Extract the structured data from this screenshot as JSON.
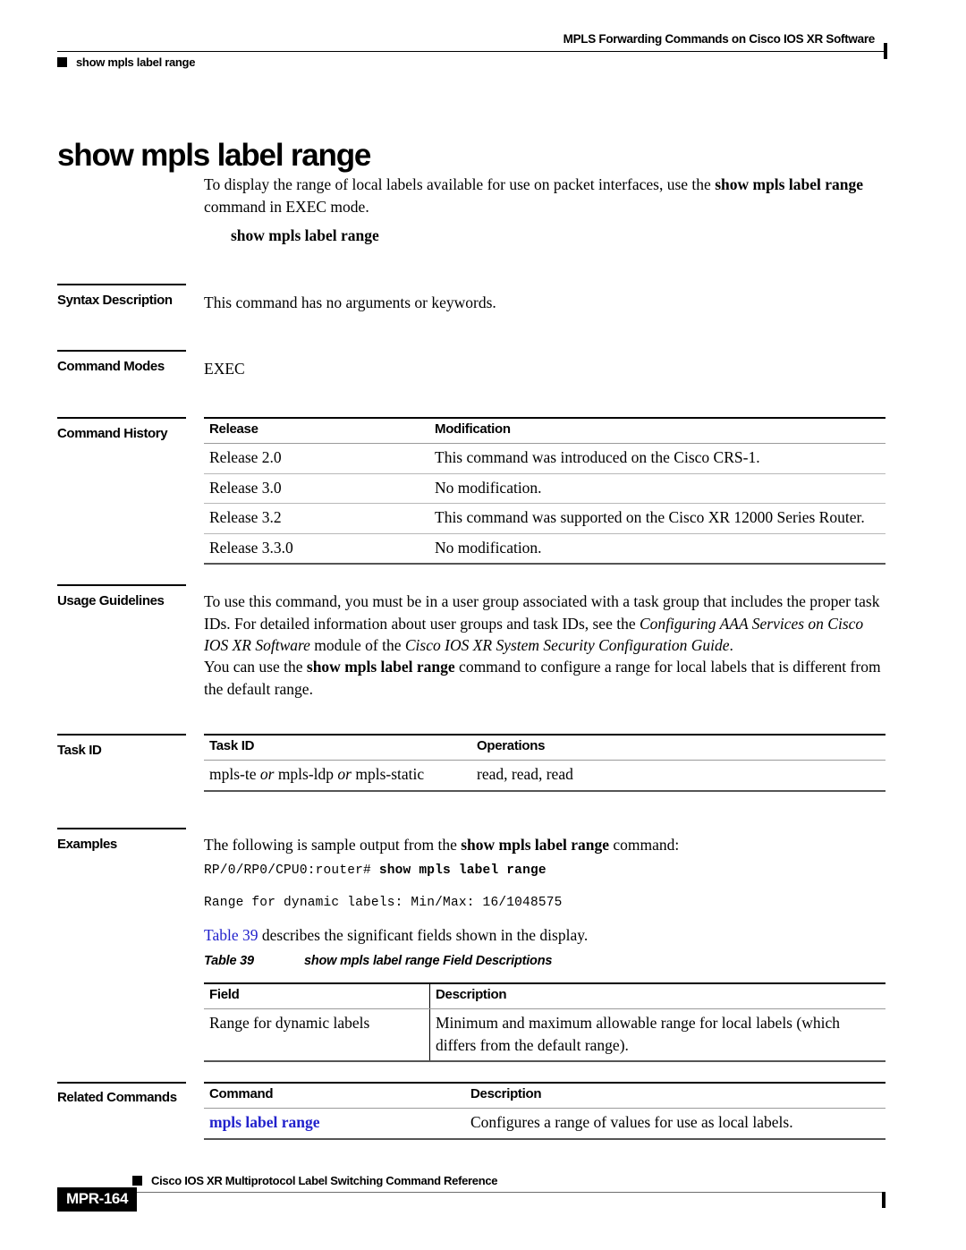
{
  "header": {
    "title": "MPLS Forwarding Commands on Cisco IOS XR Software",
    "running_head": "show mpls label range"
  },
  "page": {
    "title": "show mpls label range",
    "intro_part1": "To display the range of local labels available for use on packet interfaces, use the ",
    "intro_command": "show mpls label range",
    "intro_part2": " command in EXEC mode.",
    "syntax": "show mpls label range"
  },
  "sections": {
    "syntax_description": {
      "label": "Syntax Description",
      "body": "This command has no arguments or keywords."
    },
    "command_modes": {
      "label": "Command Modes",
      "body": "EXEC"
    },
    "command_history": {
      "label": "Command History",
      "headers": [
        "Release",
        "Modification"
      ],
      "rows": [
        [
          "Release 2.0",
          "This command was introduced on the Cisco CRS-1."
        ],
        [
          "Release 3.0",
          "No modification."
        ],
        [
          "Release 3.2",
          "This command was supported on the Cisco XR 12000 Series Router."
        ],
        [
          "Release 3.3.0",
          "No modification."
        ]
      ]
    },
    "usage_guidelines": {
      "label": "Usage Guidelines",
      "para1_a": "To use this command, you must be in a user group associated with a task group that includes the proper task IDs. For detailed information about user groups and task IDs, see the ",
      "para1_italic1": "Configuring AAA Services on Cisco IOS XR Software",
      "para1_b": " module of the ",
      "para1_italic2": "Cisco IOS XR System Security Configuration Guide",
      "para1_c": ".",
      "para2_a": "You can use the ",
      "para2_command": "show mpls label range",
      "para2_b": " command to configure a range for local labels that is different from the default range."
    },
    "task_id": {
      "label": "Task ID",
      "headers": [
        "Task ID",
        "Operations"
      ],
      "row_task_a": "mpls-te ",
      "row_task_or1": "or",
      "row_task_b": " mpls-ldp ",
      "row_task_or2": "or",
      "row_task_c": " mpls-static",
      "row_operations": "read, read, read"
    },
    "examples": {
      "label": "Examples",
      "intro_a": "The following is sample output from the ",
      "intro_command": "show mpls label range",
      "intro_b": " command:",
      "code_prompt": "RP/0/RP0/CPU0:router# ",
      "code_command": "show mpls label range",
      "code_output": "Range for dynamic labels: Min/Max: 16/1048575",
      "table_ref_link": "Table 39",
      "table_ref_text": " describes the significant fields shown in the display.",
      "caption_number": "Table 39",
      "caption_text": "show mpls label range Field Descriptions",
      "headers": [
        "Field",
        "Description"
      ],
      "rows": [
        [
          "Range for dynamic labels",
          "Minimum and maximum allowable range for local labels (which differs from the default range)."
        ]
      ]
    },
    "related_commands": {
      "label": "Related Commands",
      "headers": [
        "Command",
        "Description"
      ],
      "rows": [
        {
          "command": "mpls label range",
          "description": "Configures a range of values for use as local labels."
        }
      ]
    }
  },
  "footer": {
    "book_title": "Cisco IOS XR Multiprotocol Label Switching Command Reference",
    "page_number": "MPR-164"
  },
  "colors": {
    "link": "#2222cc",
    "text": "#000000",
    "rule": "#000000"
  }
}
